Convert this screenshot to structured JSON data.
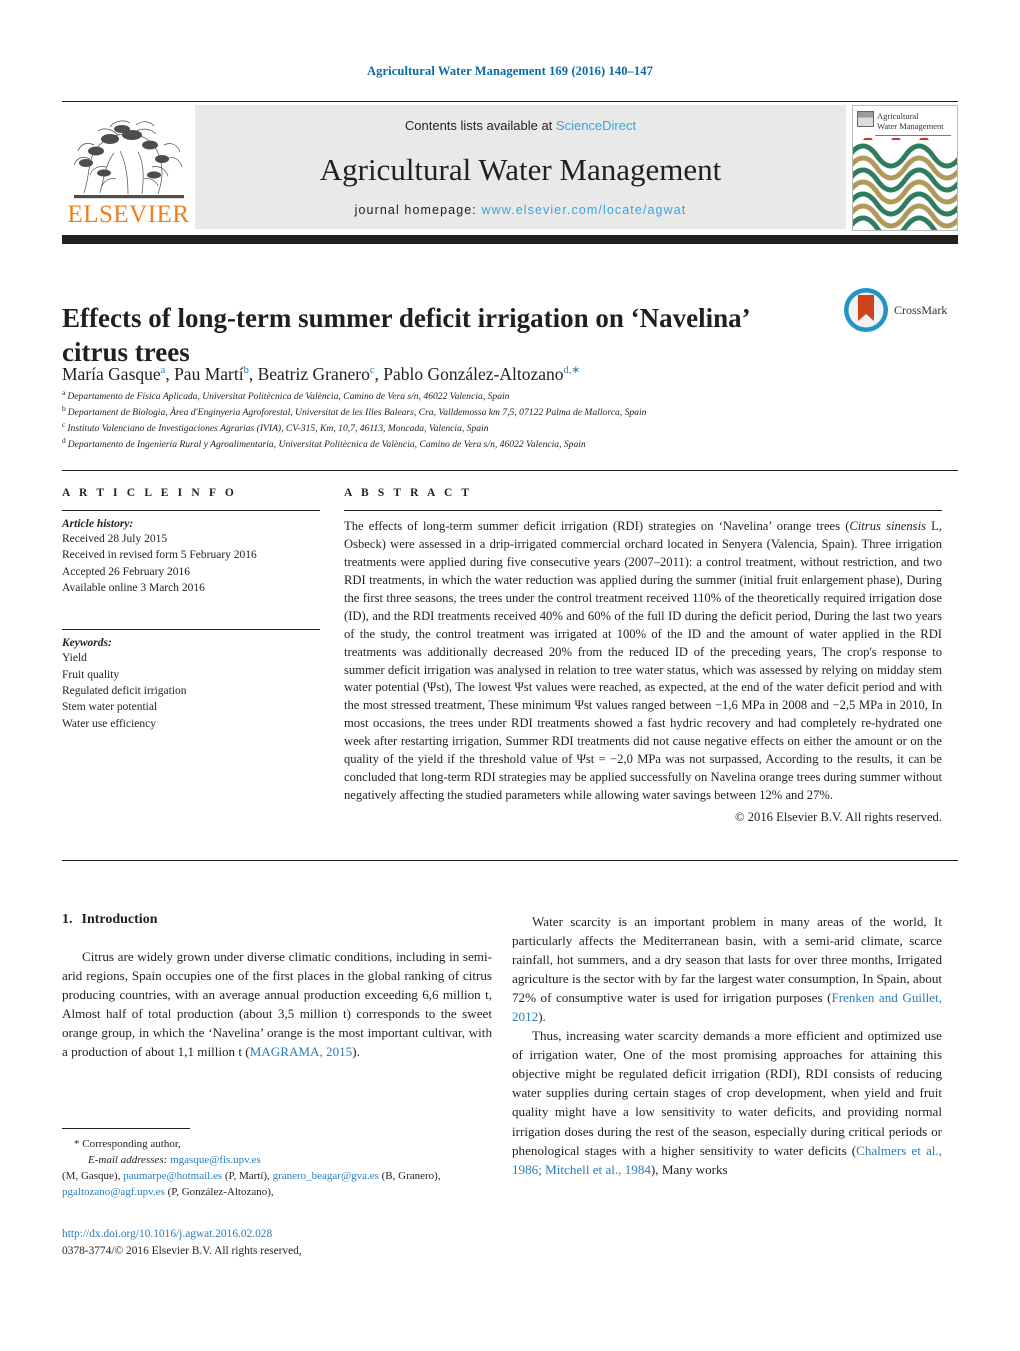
{
  "running_head": "Agricultural Water Management 169 (2016) 140–147",
  "masthead": {
    "publisher": "ELSEVIER",
    "contents_prefix": "Contents lists available at ",
    "contents_link": "ScienceDirect",
    "journal_name": "Agricultural Water Management",
    "homepage_prefix": "journal homepage: ",
    "homepage_url": "www.elsevier.com/locate/agwat",
    "cover_title_line1": "Agricultural",
    "cover_title_line2": "Water Management"
  },
  "crossmark": {
    "label": "CrossMark"
  },
  "title": "Effects of long-term summer deficit irrigation on ‘Navelina’ citrus trees",
  "authors": [
    {
      "name": "María Gasque",
      "mark": "a",
      "sep": ", "
    },
    {
      "name": "Pau Martí",
      "mark": "b",
      "sep": ", "
    },
    {
      "name": "Beatriz Granero",
      "mark": "c",
      "sep": ", "
    },
    {
      "name": "Pablo González-Altozano",
      "mark": "d,∗",
      "sep": ""
    }
  ],
  "affiliations": [
    {
      "mark": "a",
      "text": "Departamento de Física Aplicada, Universitat Politècnica de València, Camino de Vera s/n, 46022 Valencia, Spain"
    },
    {
      "mark": "b",
      "text": "Departament de Biologia, Àrea d'Enginyeria Agroforestal, Universitat de les Illes Balears, Cra, Valldemossa km 7,5, 07122 Palma de Mallorca, Spain"
    },
    {
      "mark": "c",
      "text": "Instituto Valenciano de Investigaciones Agrarias (IVIA), CV-315, Km, 10,7, 46113, Moncada, Valencia, Spain"
    },
    {
      "mark": "d",
      "text": "Departamento de Ingeniería Rural y Agroalimentaria, Universitat Politècnica de València, Camino de Vera s/n, 46022 Valencia, Spain"
    }
  ],
  "article_info": {
    "heading": "A R T I C L E  I N F O",
    "history_label": "Article history:",
    "history": [
      "Received 28 July 2015",
      "Received in revised form 5 February 2016",
      "Accepted 26 February 2016",
      "Available online 3 March 2016"
    ],
    "keywords_label": "Keywords:",
    "keywords": [
      "Yield",
      "Fruit quality",
      "Regulated deficit irrigation",
      "Stem water potential",
      "Water use efficiency"
    ]
  },
  "abstract": {
    "heading": "A B S T R A C T",
    "part1": "The effects of long-term summer deficit irrigation (RDI) strategies on ‘Navelina’ orange trees (",
    "species_italic": "Citrus sinensis",
    "part2": " L, Osbeck) were assessed in a drip-irrigated commercial orchard located in Senyera (Valencia, Spain). Three irrigation treatments were applied during five consecutive years (2007–2011): a control treatment, without restriction, and two RDI treatments, in which the water reduction was applied during the summer (initial fruit enlargement phase), During the first three seasons, the trees under the control treatment received 110% of the theoretically required irrigation dose (ID), and the RDI treatments received 40% and 60% of the full ID during the deficit period, During the last two years of the study, the control treatment was irrigated at 100% of the ID and the amount of water applied in the RDI treatments was additionally decreased 20% from the reduced ID of the preceding years, The crop's response to summer deficit irrigation was analysed in relation to tree water status, which was assessed by relying on midday stem water potential (Ψst), The lowest Ψst values were reached, as expected, at the end of the water deficit period and with the most stressed treatment, These minimum Ψst values ranged between −1,6 MPa in 2008 and −2,5 MPa in 2010, In most occasions, the trees under RDI treatments showed a fast hydric recovery and had completely re-hydrated one week after restarting irrigation, Summer RDI treatments did not cause negative effects on either the amount or on the quality of the yield if the threshold value of Ψst = −2,0 MPa was not surpassed, According to the results, it can be concluded that long-term RDI strategies may be applied successfully on Navelina orange trees during summer without negatively affecting the studied parameters while allowing water savings between 12% and 27%.",
    "copyright": "© 2016 Elsevier B.V. All rights reserved."
  },
  "introduction": {
    "number": "1.",
    "heading": "Introduction",
    "left_p1_a": "Citrus are widely grown under diverse climatic conditions, including in semi-arid regions, Spain occupies one of the first places in the global ranking of citrus producing countries, with an average annual production exceeding 6,6 million t, Almost half of total production (about 3,5 million t) corresponds to the sweet orange group, in which the ‘Navelina’ orange is the most important cultivar, with a production of about 1,1 million t (",
    "left_p1_cite": "MAGRAMA, 2015",
    "left_p1_b": ").",
    "right_p1_a": "Water scarcity is an important problem in many areas of the world, It particularly affects the Mediterranean basin, with a semi-arid climate, scarce rainfall, hot summers, and a dry season that lasts for over three months, Irrigated agriculture is the sector with by far the largest water consumption, In Spain, about 72% of consumptive water is used for irrigation purposes (",
    "right_p1_cite": "Frenken and Guillet, 2012",
    "right_p1_b": ").",
    "right_p2_a": "Thus, increasing water scarcity demands a more efficient and optimized use of irrigation water, One of the most promising approaches for attaining this objective might be regulated deficit irrigation (RDI), RDI consists of reducing water supplies during certain stages of crop development, when yield and fruit quality might have a low sensitivity to water deficits, and providing normal irrigation doses during the rest of the season, especially during critical periods or phenological stages with a higher sensitivity to water deficits (",
    "right_p2_cite": "Chalmers et al., 1986; Mitchell et al., 1984",
    "right_p2_b": "), Many works"
  },
  "footnote": {
    "corresponding": "* Corresponding author,",
    "email_label": "E-mail addresses:",
    "email1": "mgasque@fis.upv.es",
    "name1": " (M, Gasque), ",
    "email2": "paumarpe@hotmail.es",
    "name2": " (P, Martí), ",
    "email3": "granero_beagar@gva.es",
    "name3": " (B, Granero), ",
    "email4": "pgaltozano@agf.upv.es",
    "name4": " (P, González-Altozano),"
  },
  "doi": {
    "url": "http://dx.doi.org/10.1016/j.agwat.2016.02.028",
    "issn": "0378-3774/© 2016 Elsevier B.V. All rights reserved,"
  },
  "colors": {
    "accent_blue": "#2b7bb9",
    "link_blue": "#3ba3dd",
    "elsevier_orange": "#f07f1a",
    "bar_black": "#231f20",
    "masthead_gray": "#e9e9e9"
  }
}
